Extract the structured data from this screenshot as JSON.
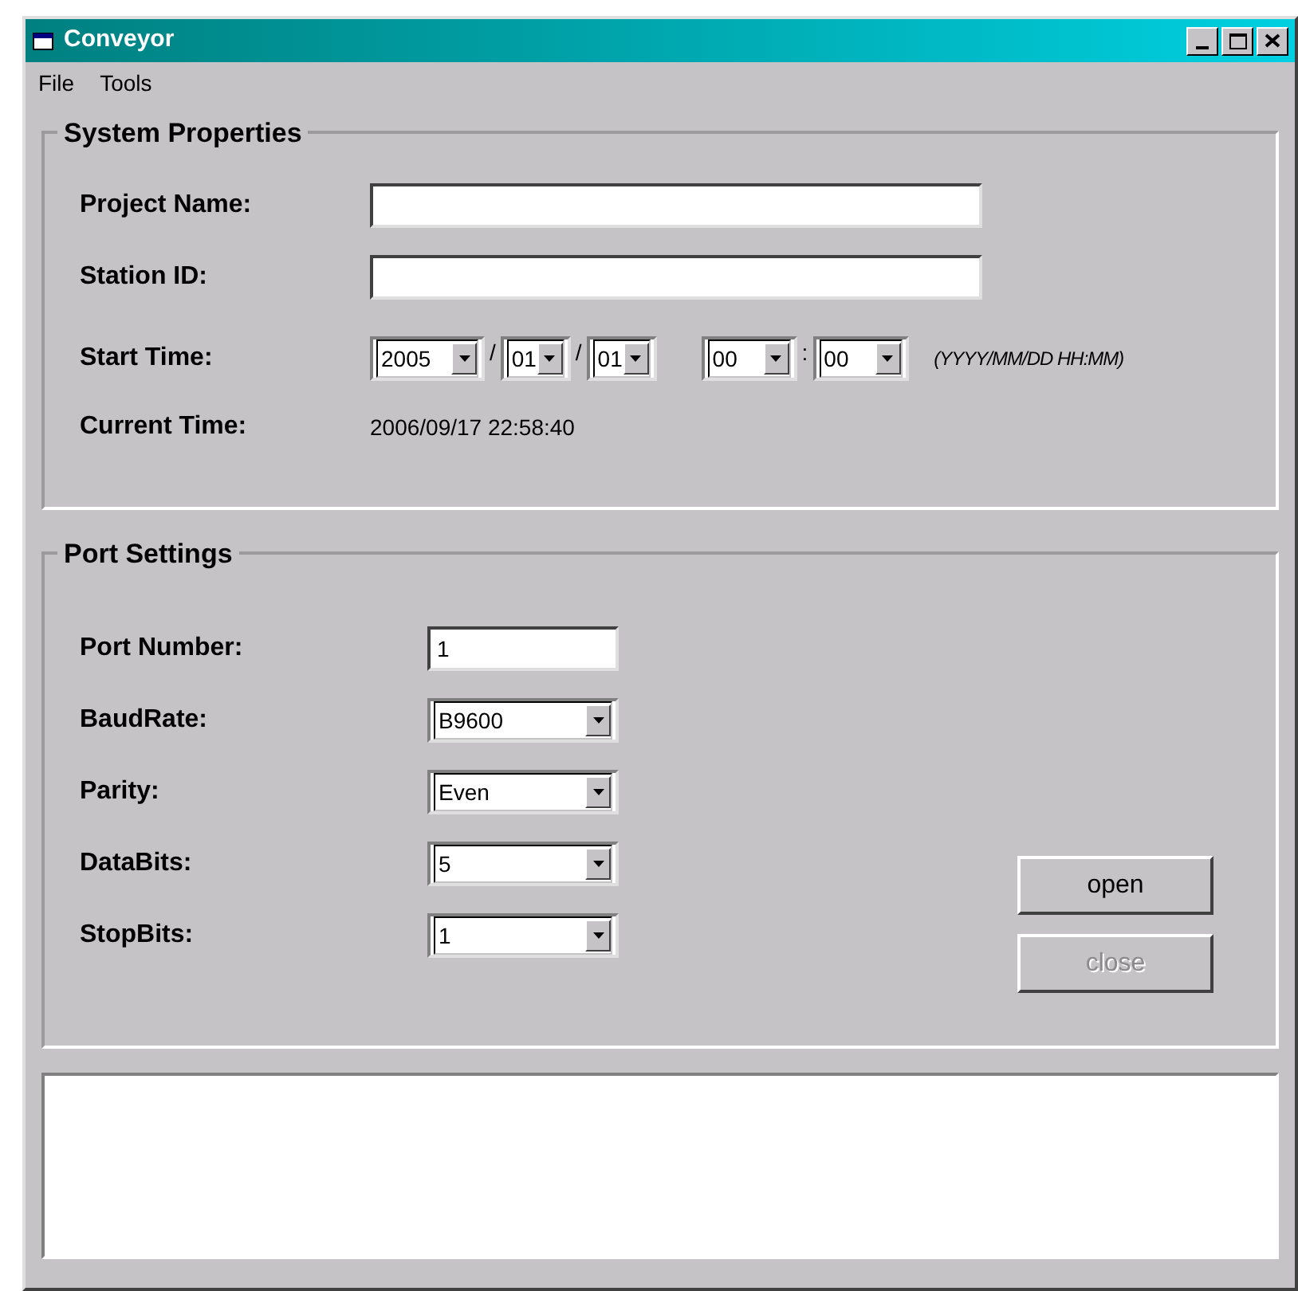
{
  "window": {
    "title": "Conveyor"
  },
  "menu": [
    "File",
    "Tools"
  ],
  "system_properties": {
    "title": "System Properties",
    "project_name": {
      "label": "Project Name:"
    },
    "station_id": {
      "label": "Station ID:"
    },
    "start_time": {
      "label": "Start Time:",
      "parts": [
        {
          "kind": "combo",
          "value": "2005"
        },
        {
          "kind": "separator",
          "text": "/"
        },
        {
          "kind": "combo",
          "value": "01"
        },
        {
          "kind": "separator",
          "text": "/"
        },
        {
          "kind": "combo",
          "value": "01"
        },
        {
          "kind": "gap"
        },
        {
          "kind": "combo",
          "value": "00"
        },
        {
          "kind": "separator",
          "text": ":"
        },
        {
          "kind": "combo",
          "value": "00"
        }
      ],
      "hint": "(YYYY/MM/DD HH:MM)"
    },
    "current_time": {
      "label": "Current Time:",
      "value": "2006/09/17 22:58:40"
    }
  },
  "port_settings": {
    "title": "Port Settings",
    "rows": [
      {
        "kind": "text",
        "label": "Port Number:",
        "value": "1"
      },
      {
        "kind": "combo",
        "label": "BaudRate:",
        "value": "B9600"
      },
      {
        "kind": "combo",
        "label": "Parity:",
        "value": "Even"
      },
      {
        "kind": "combo",
        "label": "DataBits:",
        "value": "5"
      },
      {
        "kind": "combo",
        "label": "StopBits:",
        "value": "1"
      }
    ],
    "buttons": [
      {
        "label": "open",
        "disabled": false
      },
      {
        "label": "close",
        "disabled": true
      }
    ]
  }
}
